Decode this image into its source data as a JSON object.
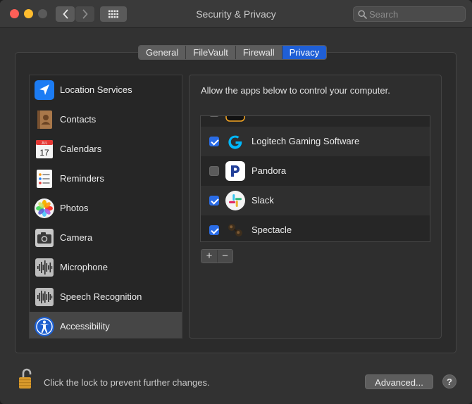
{
  "window": {
    "title": "Security & Privacy",
    "search_placeholder": "Search"
  },
  "tabs": [
    {
      "label": "General",
      "active": false
    },
    {
      "label": "FileVault",
      "active": false
    },
    {
      "label": "Firewall",
      "active": false
    },
    {
      "label": "Privacy",
      "active": true
    }
  ],
  "sidebar": {
    "items": [
      {
        "label": "Location Services",
        "icon": "location-arrow-icon"
      },
      {
        "label": "Contacts",
        "icon": "contacts-book-icon"
      },
      {
        "label": "Calendars",
        "icon": "calendar-icon",
        "icon_month": "JUL",
        "icon_day": "17"
      },
      {
        "label": "Reminders",
        "icon": "reminders-list-icon"
      },
      {
        "label": "Photos",
        "icon": "photos-flower-icon"
      },
      {
        "label": "Camera",
        "icon": "camera-icon"
      },
      {
        "label": "Microphone",
        "icon": "microphone-waveform-icon"
      },
      {
        "label": "Speech Recognition",
        "icon": "speech-waveform-icon"
      },
      {
        "label": "Accessibility",
        "icon": "accessibility-person-icon",
        "selected": true
      }
    ]
  },
  "panel": {
    "description": "Allow the apps below to control your computer.",
    "apps": [
      {
        "name": "Logitech Gaming Software",
        "checked": true,
        "icon": "logitech-g-icon"
      },
      {
        "name": "Pandora",
        "checked": false,
        "icon": "pandora-p-icon"
      },
      {
        "name": "Slack",
        "checked": true,
        "icon": "slack-icon"
      },
      {
        "name": "Spectacle",
        "checked": true,
        "icon": "spectacle-icon"
      }
    ],
    "add_label": "+",
    "remove_label": "−"
  },
  "footer": {
    "lock_text": "Click the lock to prevent further changes.",
    "advanced_label": "Advanced...",
    "help_label": "?"
  },
  "colors": {
    "accent": "#1f5fd6",
    "checkbox_checked": "#2a6ce6",
    "close": "#fe5f57",
    "minimize": "#febc2e"
  }
}
